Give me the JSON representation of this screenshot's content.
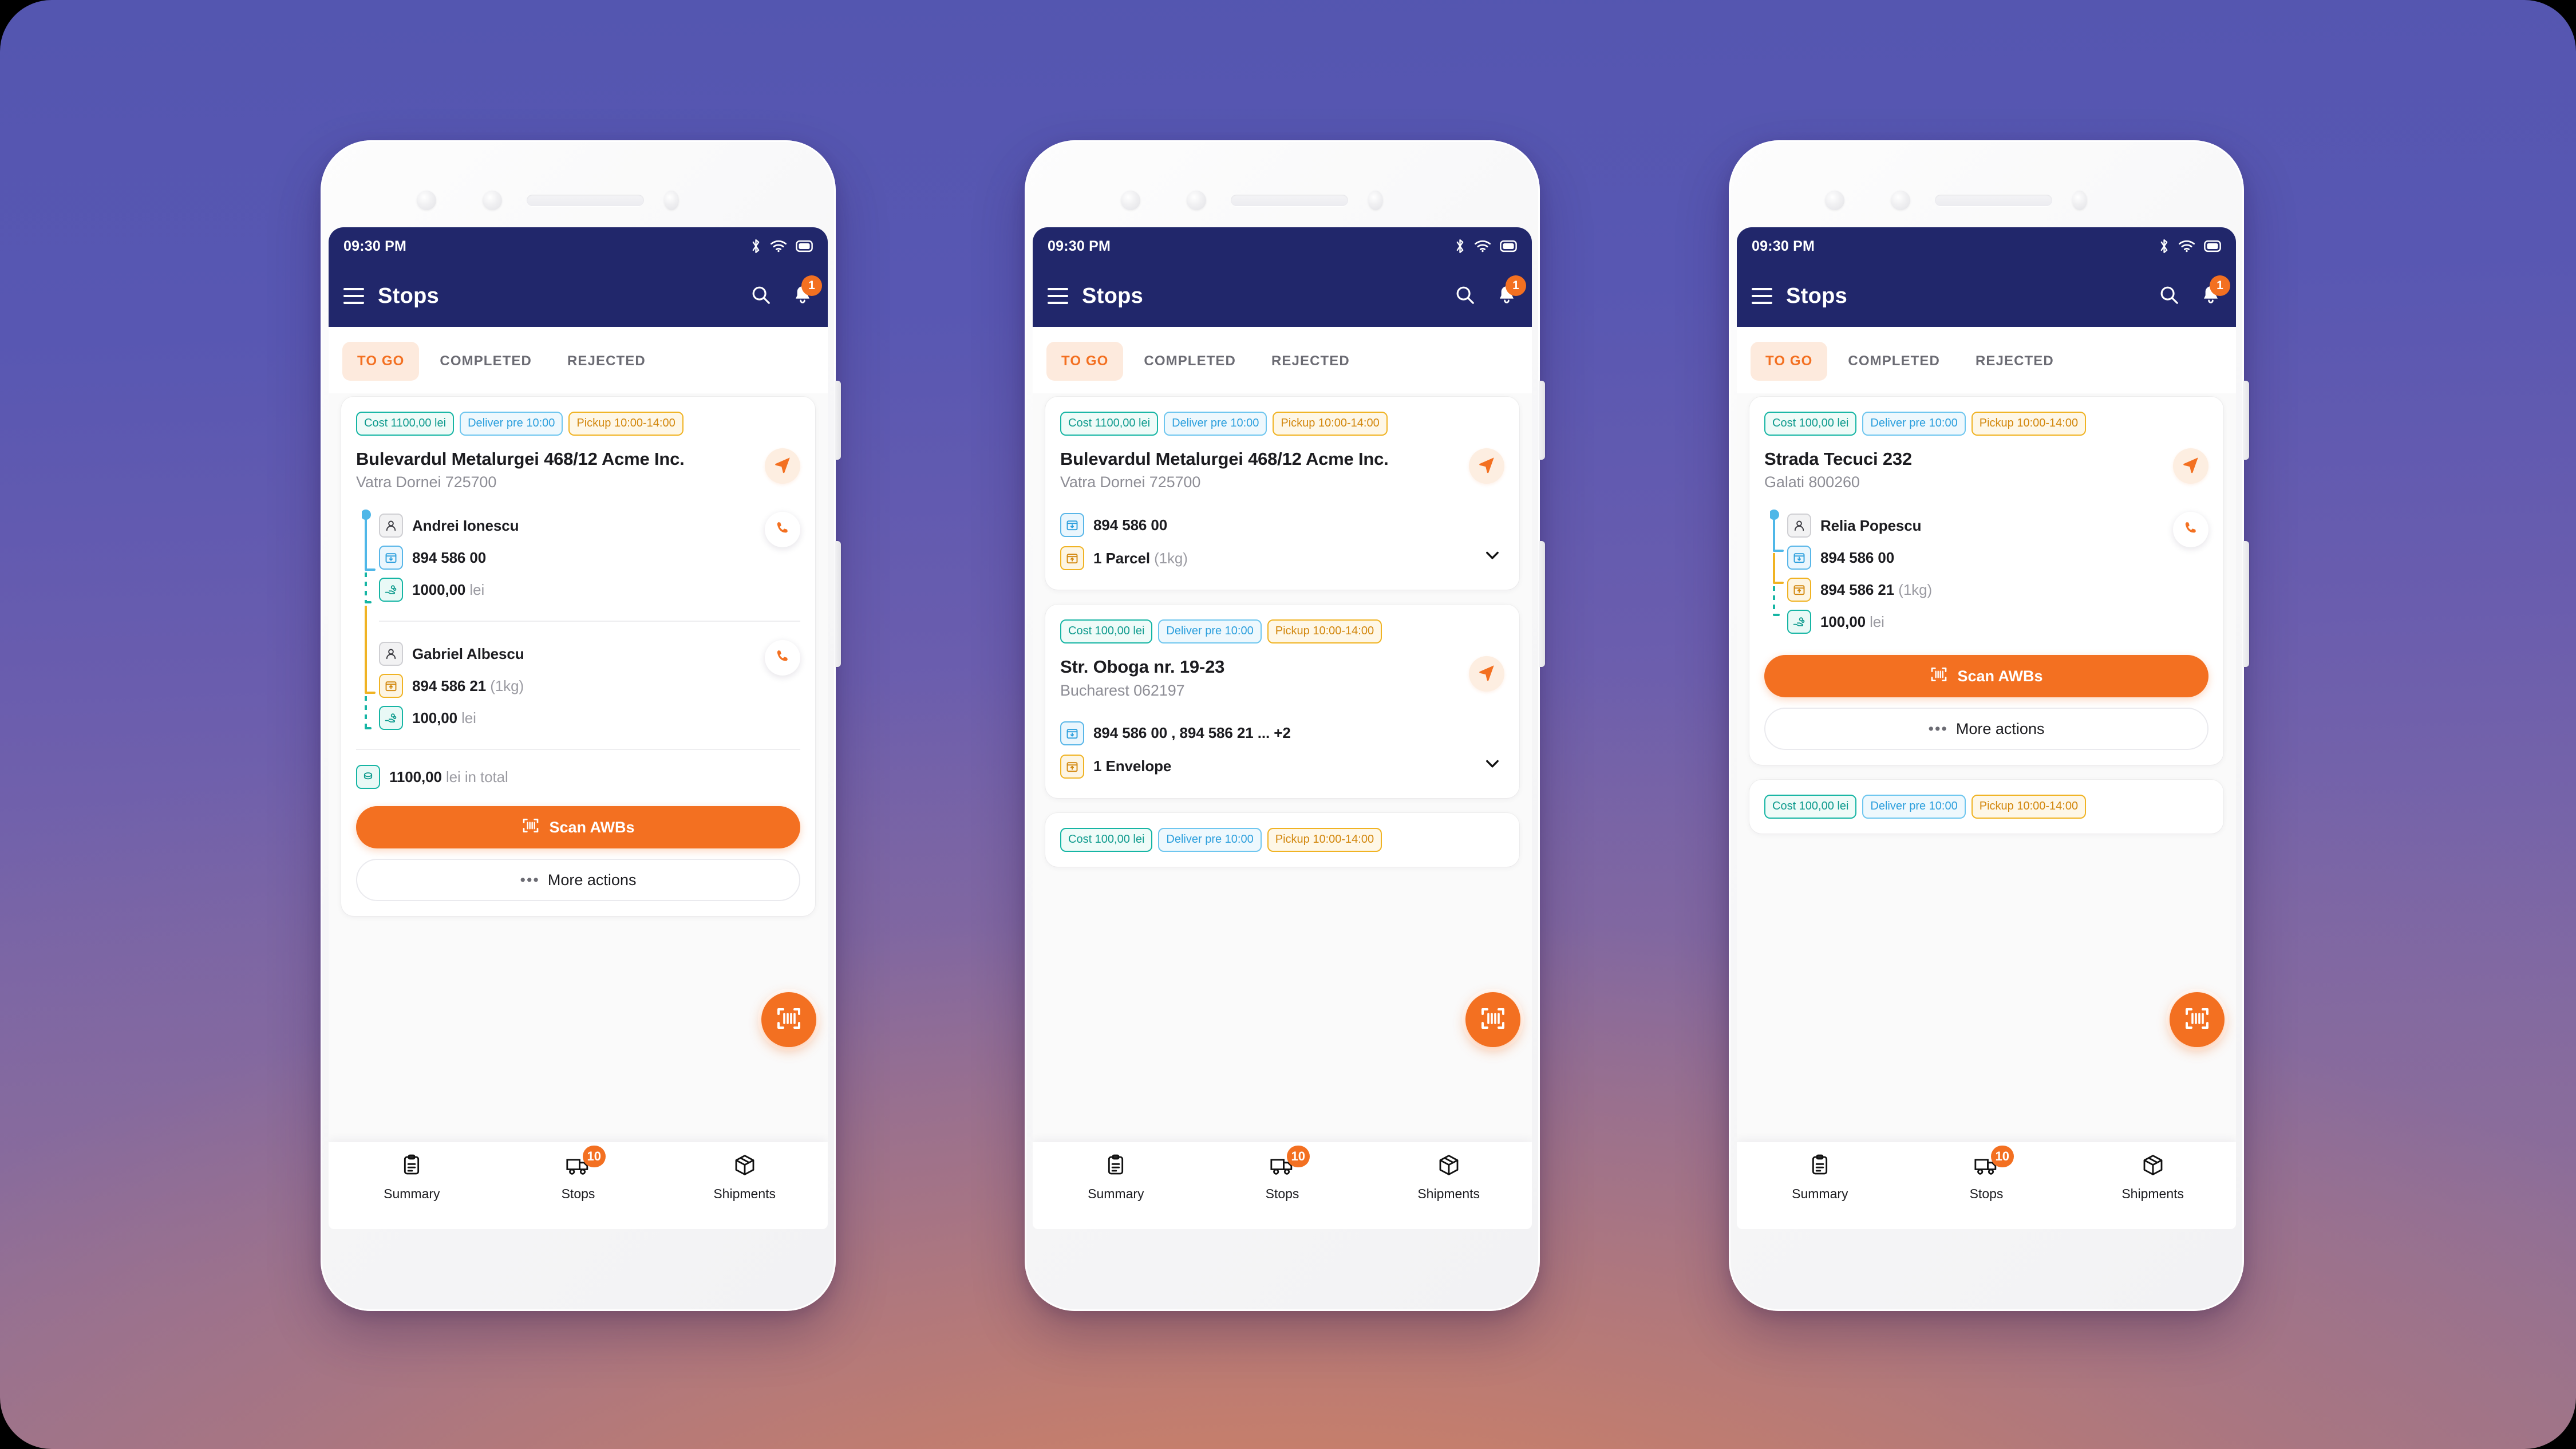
{
  "colors": {
    "appbar": "#21276b",
    "accent": "#f37021",
    "cost_green": "#0f9b8e",
    "deliver_blue": "#2c9fdd",
    "pickup_amber": "#d2870d"
  },
  "status_bar": {
    "time": "09:30 PM",
    "icons": [
      "bluetooth-icon",
      "wifi-icon",
      "battery-icon"
    ]
  },
  "appbar": {
    "title": "Stops",
    "menu_icon": "hamburger-icon",
    "search_icon": "search-icon",
    "notifications_icon": "bell-icon",
    "notification_count": "1"
  },
  "tabs": [
    {
      "label": "TO GO",
      "active": true
    },
    {
      "label": "COMPLETED",
      "active": false
    },
    {
      "label": "REJECTED",
      "active": false
    }
  ],
  "bottom_nav": [
    {
      "label": "Summary",
      "icon": "clipboard-icon",
      "badge": ""
    },
    {
      "label": "Stops",
      "icon": "truck-icon",
      "badge": "10"
    },
    {
      "label": "Shipments",
      "icon": "package-icon",
      "badge": ""
    }
  ],
  "buttons": {
    "scan_awbs": "Scan AWBs",
    "more_actions": "More actions",
    "scan_icon": "barcode-scan-icon",
    "more_icon": "ellipsis-icon",
    "navigate_icon": "navigation-arrow-icon",
    "call_icon": "phone-icon",
    "expand_icon": "chevron-down-icon"
  },
  "phone1": {
    "card": {
      "chips": {
        "cost": "Cost 1100,00 lei",
        "deliver": "Deliver pre 10:00",
        "pickup": "Pickup 10:00-14:00"
      },
      "address_title": "Bulevardul Metalurgei 468/12 Acme Inc.",
      "address_sub": "Vatra Dornei 725700",
      "groups": [
        {
          "person": "Andrei Ionescu",
          "awb": "894 586 00",
          "awb_weight": "",
          "awb_kind": "drop",
          "amount": "1000,00",
          "currency": "lei"
        },
        {
          "person": "Gabriel Albescu",
          "awb": "894 586 21",
          "awb_weight": "(1kg)",
          "awb_kind": "pick",
          "amount": "100,00",
          "currency": "lei"
        }
      ],
      "total_amount": "1100,00",
      "total_suffix": "lei in total"
    }
  },
  "phone2": {
    "card1": {
      "chips": {
        "cost": "Cost 1100,00 lei",
        "deliver": "Deliver pre 10:00",
        "pickup": "Pickup 10:00-14:00"
      },
      "address_title": "Bulevardul Metalurgei 468/12 Acme Inc.",
      "address_sub": "Vatra Dornei 725700",
      "rows": [
        {
          "kind": "drop",
          "text": "894 586 00",
          "muted": ""
        },
        {
          "kind": "pick",
          "text": "1 Parcel",
          "muted": "(1kg)"
        }
      ]
    },
    "card2": {
      "chips": {
        "cost": "Cost 100,00 lei",
        "deliver": "Deliver pre 10:00",
        "pickup": "Pickup 10:00-14:00"
      },
      "address_title": "Str. Oboga nr. 19-23",
      "address_sub": "Bucharest 062197",
      "rows": [
        {
          "kind": "drop",
          "text": "894 586 00 , 894 586 21 ... +2",
          "muted": ""
        },
        {
          "kind": "pick",
          "text": "1 Envelope",
          "muted": ""
        }
      ]
    },
    "card3_peek": {
      "chips": {
        "cost": "Cost 100,00 lei",
        "deliver": "Deliver pre 10:00",
        "pickup": "Pickup 10:00-14:00"
      }
    }
  },
  "phone3": {
    "card": {
      "chips": {
        "cost": "Cost 100,00 lei",
        "deliver": "Deliver pre 10:00",
        "pickup": "Pickup 10:00-14:00"
      },
      "address_title": "Strada Tecuci 232",
      "address_sub": "Galati 800260",
      "group": {
        "person": "Relia Popescu",
        "awb_drop": "894 586 00",
        "awb_pick": "894 586 21",
        "awb_pick_weight": "(1kg)",
        "amount": "100,00",
        "currency": "lei"
      }
    },
    "card2_peek": {
      "chips": {
        "cost": "Cost 100,00 lei",
        "deliver": "Deliver pre 10:00",
        "pickup": "Pickup 10:00-14:00"
      }
    }
  }
}
